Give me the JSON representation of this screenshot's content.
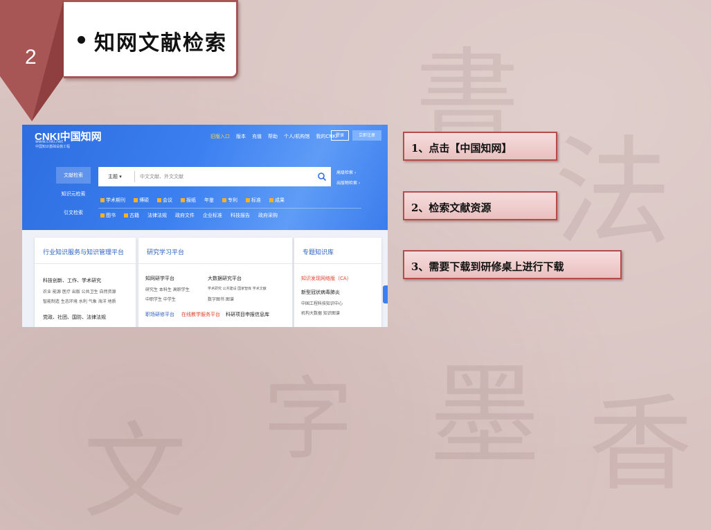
{
  "slide": {
    "number": "2",
    "title": "知网文献检索",
    "steps": [
      "1、点击【中国知网】",
      "2、检索文献资源",
      "3、需要下载到研修桌上进行下载"
    ]
  },
  "colors": {
    "accent": "#b74a4a",
    "marker": "#a85555",
    "cnki_blue": "#3b7ff0"
  },
  "cnki": {
    "logo": "CNKI中国知网",
    "url": "www.cnki.net",
    "tagline": "中国知识基础设施工程",
    "nav": [
      "旧版入口",
      "版本",
      "充值",
      "帮助",
      "个人/机构馆",
      "我的CNKI"
    ],
    "login": "登录",
    "register": "立即注册",
    "side_tabs": [
      "文献检索",
      "知识元检索",
      "引文检索"
    ],
    "search_scope": "主题 ▾",
    "search_placeholder": "中文文献、外文文献",
    "adv_links": [
      "高级检索 ›",
      "出版物检索 ›"
    ],
    "check_row1": [
      "学术期刊",
      "博硕",
      "会议",
      "报纸",
      "年鉴",
      "专利",
      "标准",
      "成果"
    ],
    "check_row2": [
      "图书",
      "古籍",
      "法律法规",
      "政府文件",
      "企业标准",
      "科技报告",
      "政府采购"
    ],
    "cards": [
      {
        "title": "行业知识服务与知识管理平台",
        "lines": [
          "科技创新、工作、学术研究",
          "农业  能源  医疗  出版  公共卫生  自然资源",
          "智能制造  生态环境  水利  气象  海洋  地质",
          "党政、社团、国防、法律法规"
        ]
      },
      {
        "title": "研究学习平台",
        "lines": [
          "知网研学平台",
          "研究生  本科生  高职学生",
          "中职学生  中学生",
          "大数据研究平台",
          "学术研究  公共建设  国家智库  学术文献",
          "数字图书  图谱",
          "职场研修平台",
          "在线教学服务平台",
          "科研项目申报信息库"
        ]
      },
      {
        "title": "专题知识库",
        "lines": [
          "知识发现网络版（CA）",
          "新型冠状病毒肺炎",
          "中国工程科技知识中心",
          "机构大数据  知识图谱"
        ]
      }
    ]
  }
}
